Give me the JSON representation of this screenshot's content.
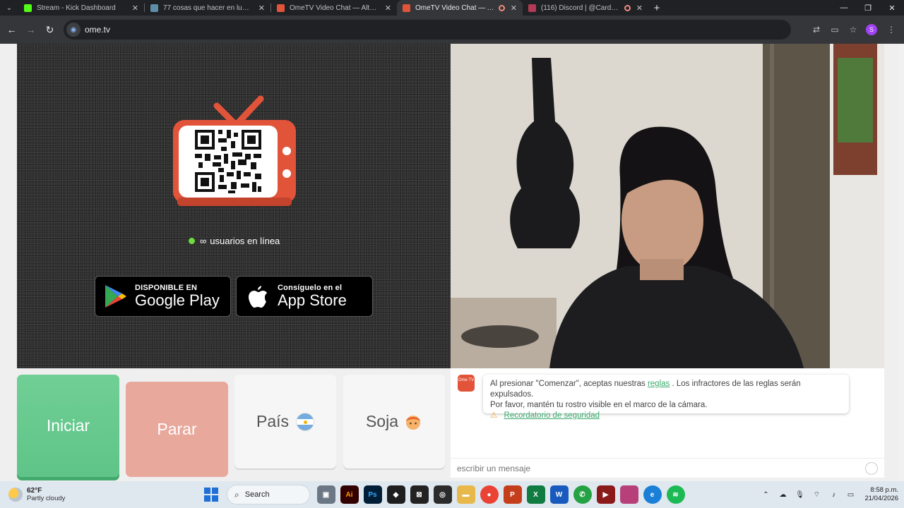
{
  "browser": {
    "tabs": [
      {
        "title": "Stream - Kick Dashboard",
        "favicon_color": "#53fc18",
        "active": false,
        "recording": false
      },
      {
        "title": "77 cosas que hacer en lugar de",
        "favicon_color": "#5f8fa8",
        "active": false,
        "recording": false
      },
      {
        "title": "OmeTV Video Chat — Alternati",
        "favicon_color": "#e1543a",
        "active": false,
        "recording": false
      },
      {
        "title": "OmeTV Video Chat — Alter",
        "favicon_color": "#e1543a",
        "active": true,
        "recording": true
      },
      {
        "title": "(116) Discord | @Cardona",
        "favicon_color": "#b43a55",
        "active": false,
        "recording": true
      }
    ],
    "url": "ome.tv",
    "profile_initial": "S"
  },
  "page": {
    "online_count": "∞",
    "online_label": "usuarios en línea",
    "google_play": {
      "small": "DISPONIBLE EN",
      "big": "Google Play"
    },
    "app_store": {
      "small": "Consíguelo en el",
      "big": "App Store"
    },
    "buttons": {
      "start": "Iniciar",
      "stop": "Parar",
      "country": "País",
      "gender": "Soja"
    },
    "chat": {
      "logo": "Ome TV",
      "notice_pre": "Al presionar \"Comenzar\", aceptas nuestras",
      "notice_link": "reglas",
      "notice_post": ". Los infractores de las reglas serán expulsados.",
      "notice_line2": "Por favor, mantén tu rostro visible en el marco de la cámara.",
      "safety_link": "Recordatorio de seguridad",
      "input_placeholder": "escribir un mensaje"
    }
  },
  "taskbar": {
    "weather_temp": "62°F",
    "weather_desc": "Partly cloudy",
    "search_label": "Search",
    "time": "8:58 p.m.",
    "date": "21/04/2026",
    "apps": [
      {
        "name": "illustrator",
        "label": "Ai",
        "color": "#330000"
      },
      {
        "name": "photoshop",
        "label": "Ps",
        "color": "#001e36"
      },
      {
        "name": "powerpoint",
        "label": "P",
        "color": "#c43e1c"
      },
      {
        "name": "excel",
        "label": "X",
        "color": "#107c41"
      },
      {
        "name": "word",
        "label": "W",
        "color": "#185abd"
      }
    ]
  }
}
